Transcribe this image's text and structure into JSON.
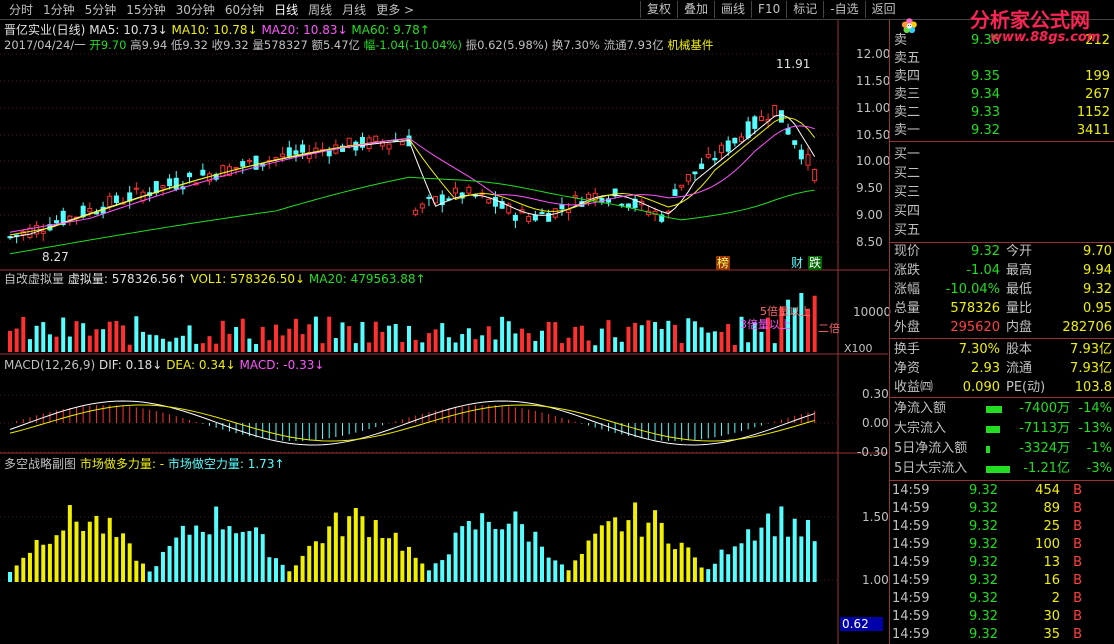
{
  "toolbar": {
    "periods": [
      "分时",
      "1分钟",
      "5分钟",
      "15分钟",
      "30分钟",
      "60分钟",
      "日线",
      "周线",
      "月线",
      "更多 >"
    ],
    "active_period": "日线",
    "buttons": [
      "复权",
      "叠加",
      "画线",
      "F10",
      "标记",
      "-自选",
      "返回"
    ]
  },
  "logo": {
    "text": "分析家公式网",
    "url": "www.88gs.com"
  },
  "main_chart": {
    "title": "晋亿实业(日线)",
    "ma5": "MA5: 10.73↓",
    "ma10": "MA10: 10.78↓",
    "ma20": "MA20: 10.83↓",
    "ma60": "MA60: 9.78↑",
    "date_line": "2017/04/24/一",
    "open": "开9.70",
    "high": "高9.94",
    "low": "低9.32",
    "close": "收9.32",
    "volume": "量578327",
    "amount": "额5.47亿",
    "change": "幅-1.04(-10.04%)",
    "amplitude": "振0.62(5.98%)",
    "turnover": "换7.30%",
    "float_cap": "流通7.93亿",
    "sector": "机械基件",
    "price_high_label": "11.91",
    "price_low_label": "8.27",
    "y_ticks": [
      "12.00",
      "11.50",
      "11.00",
      "10.50",
      "10.00",
      "9.50",
      "9.00",
      "8.50"
    ],
    "badges": [
      "榜",
      "财",
      "跌"
    ]
  },
  "volume_chart": {
    "title": "自改虚拟量",
    "virtual": "虚拟量: 578326.56↑",
    "vol1": "VOL1: 578326.50↓",
    "ma20": "MA20: 479563.88↑",
    "y_tick": "10000",
    "unit": "X100",
    "annot1": "5倍量以上",
    "annot2": "3倍量以上",
    "annot3": "二倍"
  },
  "macd_chart": {
    "title": "MACD(12,26,9)",
    "dif": "DIF: 0.18↓",
    "dea": "DEA: 0.34↓",
    "macd": "MACD: -0.33↓",
    "y_ticks": [
      "0.30",
      "0.00",
      "-0.30"
    ]
  },
  "strategy_chart": {
    "title": "多空战略副图",
    "long": "市场做多力量: -",
    "short": "市场做空力量: 1.73↑",
    "y_ticks": [
      "1.50",
      "1.00"
    ],
    "current_value": "0.62"
  },
  "order_book": {
    "asks": [
      {
        "label": "卖五",
        "price": "",
        "vol": ""
      },
      {
        "label": "卖四",
        "price": "9.35",
        "vol": "199"
      },
      {
        "label": "卖三",
        "price": "9.34",
        "vol": "267"
      },
      {
        "label": "卖二",
        "price": "9.33",
        "vol": "1152"
      },
      {
        "label": "卖一",
        "price": "9.32",
        "vol": "3411"
      }
    ],
    "ask_extra": {
      "label": "卖",
      "price": "9.36",
      "vol": "212"
    },
    "bids": [
      "买一",
      "买二",
      "买三",
      "买四",
      "买五"
    ]
  },
  "quote": [
    {
      "l1": "现价",
      "v1": "9.32",
      "l2": "今开",
      "v2": "9.70"
    },
    {
      "l1": "涨跌",
      "v1": "-1.04",
      "l2": "最高",
      "v2": "9.94"
    },
    {
      "l1": "涨幅",
      "v1": "-10.04%",
      "l2": "最低",
      "v2": "9.32"
    },
    {
      "l1": "总量",
      "v1": "578326",
      "l2": "量比",
      "v2": "0.95"
    },
    {
      "l1": "外盘",
      "v1": "295620",
      "l2": "内盘",
      "v2": "282706"
    }
  ],
  "fundamentals": [
    {
      "l1": "换手",
      "v1": "7.30%",
      "l2": "股本",
      "v2": "7.93亿"
    },
    {
      "l1": "净资",
      "v1": "2.93",
      "l2": "流通",
      "v2": "7.93亿"
    },
    {
      "l1": "收益㈣",
      "v1": "0.090",
      "l2": "PE(动)",
      "v2": "103.8"
    }
  ],
  "flows": [
    {
      "label": "净流入额",
      "val": "-7400万",
      "pct": "-14%"
    },
    {
      "label": "大宗流入",
      "val": "-7113万",
      "pct": "-13%"
    },
    {
      "label": "5日净流入额",
      "val": "-3324万",
      "pct": "-1%"
    },
    {
      "label": "5日大宗流入",
      "val": "-1.21亿",
      "pct": "-3%"
    }
  ],
  "ticks": [
    {
      "time": "14:59",
      "price": "9.32",
      "vol": "454",
      "side": "B"
    },
    {
      "time": "14:59",
      "price": "9.32",
      "vol": "89",
      "side": "B"
    },
    {
      "time": "14:59",
      "price": "9.32",
      "vol": "25",
      "side": "B"
    },
    {
      "time": "14:59",
      "price": "9.32",
      "vol": "100",
      "side": "B"
    },
    {
      "time": "14:59",
      "price": "9.32",
      "vol": "13",
      "side": "B"
    },
    {
      "time": "14:59",
      "price": "9.32",
      "vol": "16",
      "side": "B"
    },
    {
      "time": "14:59",
      "price": "9.32",
      "vol": "2",
      "side": "B"
    },
    {
      "time": "14:59",
      "price": "9.32",
      "vol": "30",
      "side": "B"
    },
    {
      "time": "14:59",
      "price": "9.32",
      "vol": "35",
      "side": "B"
    }
  ]
}
